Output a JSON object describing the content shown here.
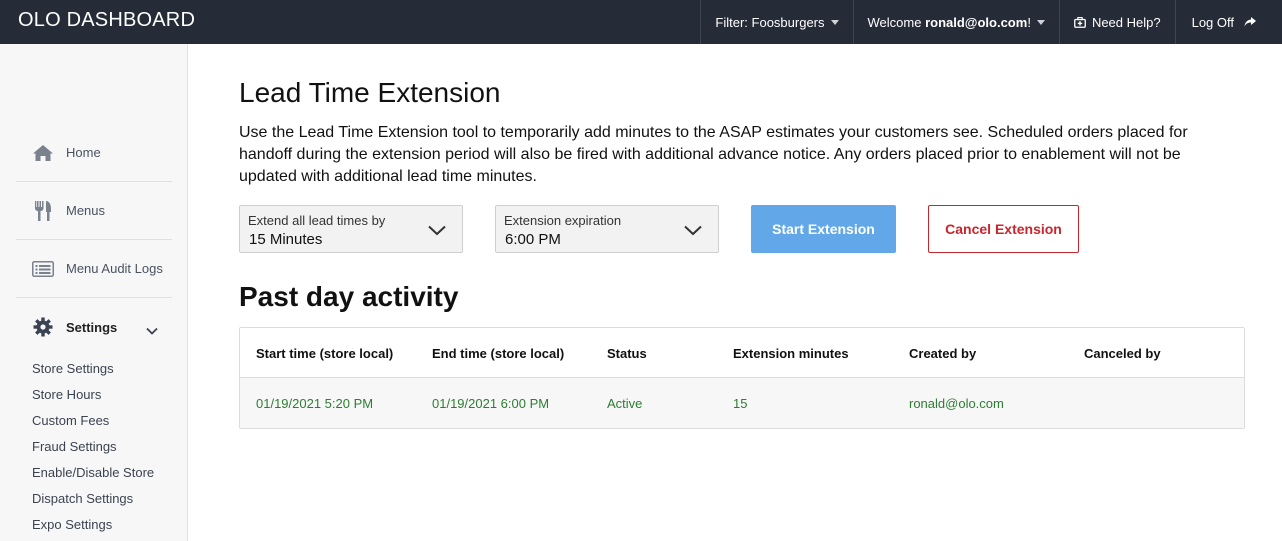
{
  "header": {
    "brand": "OLO DASHBOARD",
    "filter": "Filter: Foosburgers",
    "welcome_prefix": "Welcome ",
    "welcome_user": "ronald@olo.com",
    "welcome_suffix": "!",
    "help": "Need Help?",
    "logoff": "Log Off",
    "bg_color": "#262b38"
  },
  "sidebar": {
    "items": [
      {
        "label": "Home",
        "icon": "home-icon"
      },
      {
        "label": "Menus",
        "icon": "utensils-icon"
      },
      {
        "label": "Menu Audit Logs",
        "icon": "list-icon"
      },
      {
        "label": "Settings",
        "icon": "gear-icon"
      }
    ],
    "settings_sub": [
      "Store Settings",
      "Store Hours",
      "Custom Fees",
      "Fraud Settings",
      "Enable/Disable Store",
      "Dispatch Settings",
      "Expo Settings"
    ]
  },
  "main": {
    "title": "Lead Time Extension",
    "description": "Use the Lead Time Extension tool to temporarily add minutes to the ASAP estimates your customers see. Scheduled orders placed for handoff during the extension period will also be fired with additional advance notice. Any orders placed prior to enablement will not be updated with additional lead time minutes.",
    "extend_select": {
      "label": "Extend all lead times by",
      "value": "15 Minutes"
    },
    "expiration_select": {
      "label": "Extension expiration",
      "value": "6:00 PM"
    },
    "start_button": "Start Extension",
    "cancel_button": "Cancel Extension",
    "activity_title": "Past day activity",
    "table": {
      "headers": [
        "Start time (store local)",
        "End time (store local)",
        "Status",
        "Extension minutes",
        "Created by",
        "Canceled by"
      ],
      "rows": [
        [
          "01/19/2021 5:20 PM",
          "01/19/2021 6:00 PM",
          "Active",
          "15",
          "ronald@olo.com",
          ""
        ]
      ]
    },
    "colors": {
      "primary": "#62a8e9",
      "danger": "#c9252c",
      "active_text": "#2e7d32"
    }
  }
}
